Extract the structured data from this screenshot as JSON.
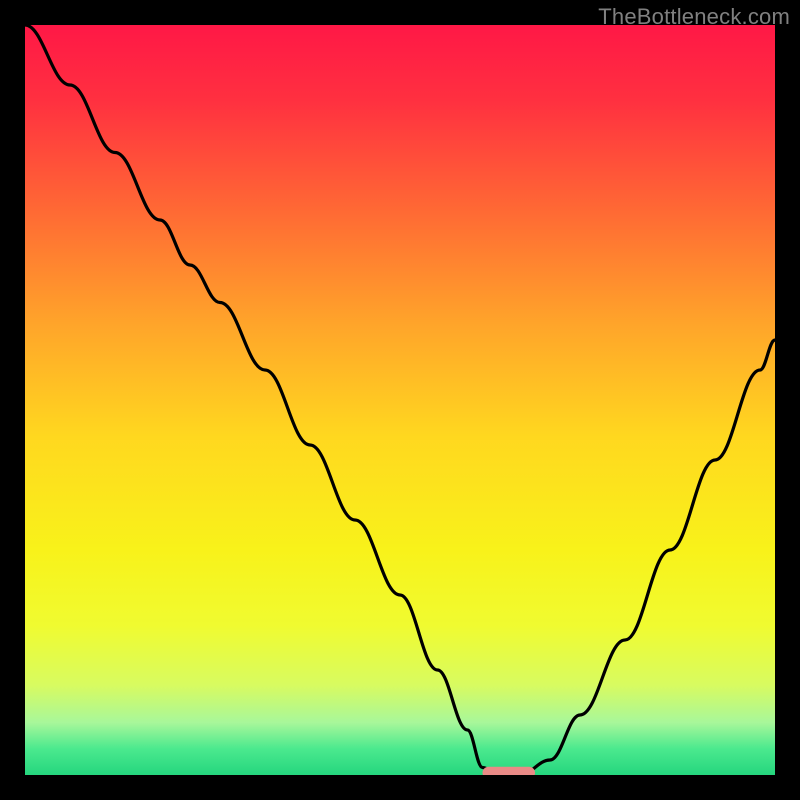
{
  "watermark": "TheBottleneck.com",
  "chart_data": {
    "type": "line",
    "title": "",
    "xlabel": "",
    "ylabel": "",
    "xlim": [
      0,
      100
    ],
    "ylim": [
      0,
      100
    ],
    "grid": false,
    "legend": false,
    "background_gradient": {
      "stops": [
        {
          "offset": 0.0,
          "color": "#ff1846"
        },
        {
          "offset": 0.1,
          "color": "#ff3040"
        },
        {
          "offset": 0.25,
          "color": "#ff6a34"
        },
        {
          "offset": 0.4,
          "color": "#ffa52a"
        },
        {
          "offset": 0.55,
          "color": "#ffd81f"
        },
        {
          "offset": 0.7,
          "color": "#f8f21a"
        },
        {
          "offset": 0.8,
          "color": "#f0fb30"
        },
        {
          "offset": 0.88,
          "color": "#d8fb60"
        },
        {
          "offset": 0.93,
          "color": "#a8f79a"
        },
        {
          "offset": 0.965,
          "color": "#4be98e"
        },
        {
          "offset": 1.0,
          "color": "#25d67e"
        }
      ]
    },
    "series": [
      {
        "name": "bottleneck-curve",
        "color": "#000000",
        "x": [
          0,
          6,
          12,
          18,
          22,
          26,
          32,
          38,
          44,
          50,
          55,
          59,
          61,
          63,
          66,
          70,
          74,
          80,
          86,
          92,
          98,
          100
        ],
        "y": [
          100,
          92,
          83,
          74,
          68,
          63,
          54,
          44,
          34,
          24,
          14,
          6,
          1,
          0,
          0,
          2,
          8,
          18,
          30,
          42,
          54,
          58
        ]
      }
    ],
    "marker": {
      "name": "optimal-range-pill",
      "x_center": 64.5,
      "y": 0.3,
      "width": 7,
      "height": 1.6,
      "color": "#e98a86"
    }
  }
}
